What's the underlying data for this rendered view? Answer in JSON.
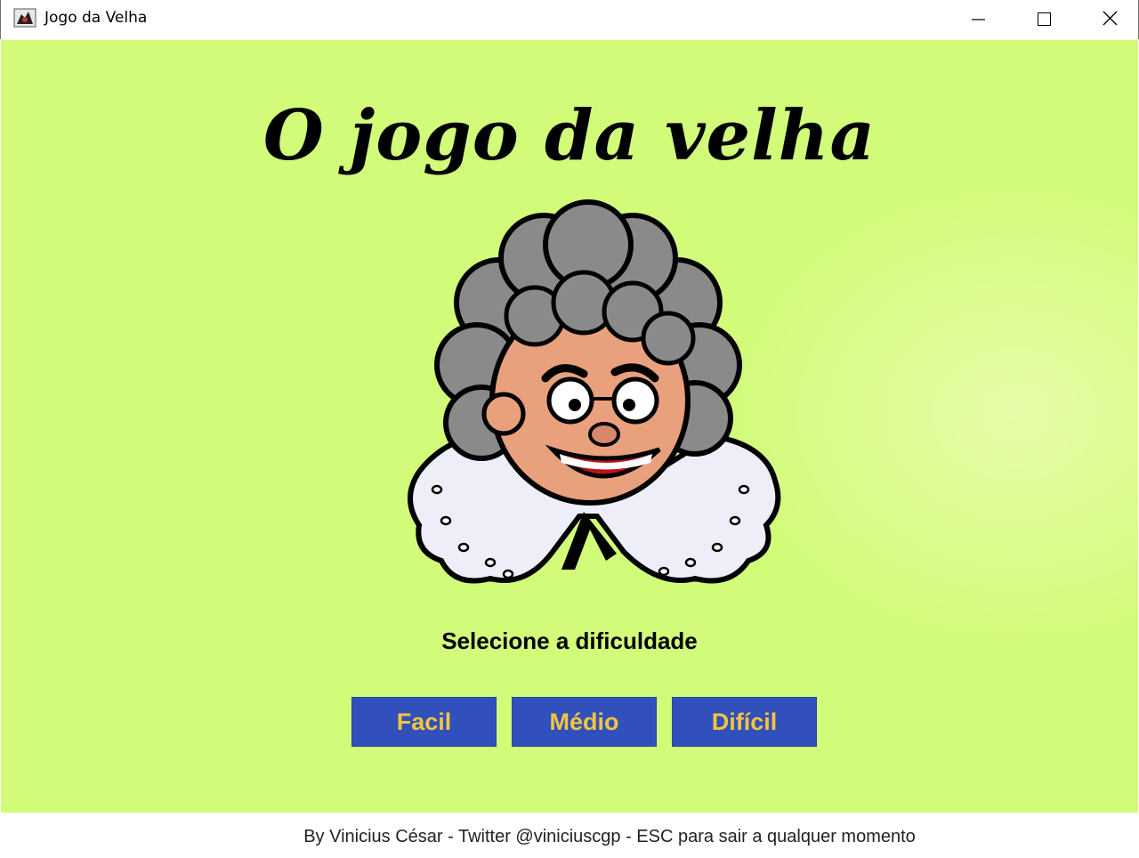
{
  "window": {
    "title": "Jogo da Velha",
    "app_icon": "java-duke-icon"
  },
  "main": {
    "background_color": "#d2fb7a",
    "title": "O jogo da velha",
    "illustration": "old-lady-cartoon",
    "prompt": "Selecione a dificuldade",
    "buttons": {
      "easy": "Facil",
      "medium": "Médio",
      "hard": "Difícil"
    },
    "button_color": "#3150bb",
    "button_text_color": "#f2c53d"
  },
  "footer": {
    "text": "By Vinicius César - Twitter @viniciuscgp - ESC para sair a qualquer momento"
  }
}
